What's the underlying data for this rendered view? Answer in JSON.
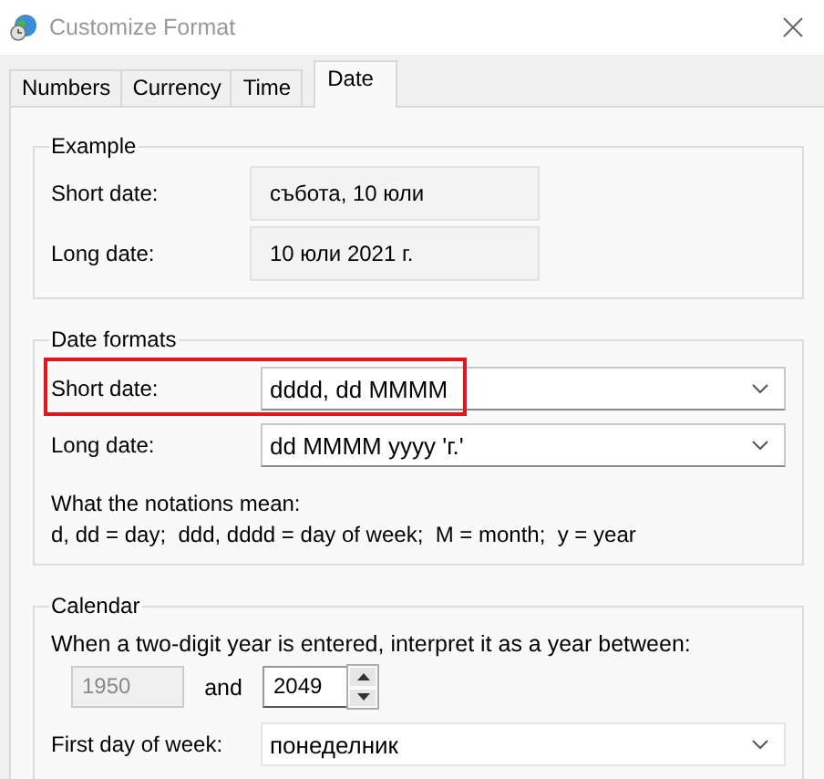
{
  "window": {
    "title": "Customize Format"
  },
  "tabs": [
    {
      "label": "Numbers",
      "selected": false
    },
    {
      "label": "Currency",
      "selected": false
    },
    {
      "label": "Time",
      "selected": false
    },
    {
      "label": "Date",
      "selected": true
    }
  ],
  "example": {
    "title": "Example",
    "rows": [
      {
        "label": "Short date:",
        "value": "събота, 10 юли"
      },
      {
        "label": "Long date:",
        "value": "10 юли 2021 г."
      }
    ]
  },
  "date_formats": {
    "title": "Date formats",
    "rows": [
      {
        "label": "Short date:",
        "value": "dddd, dd MMMM",
        "highlighted": true
      },
      {
        "label": "Long date:",
        "value": "dd MMMM yyyy 'г.'",
        "highlighted": false
      }
    ],
    "notation_title": "What the notations mean:",
    "notation": "d, dd = day;  ddd, dddd = day of week;  M = month;  y = year"
  },
  "calendar": {
    "title": "Calendar",
    "prompt": "When a two-digit year is entered, interpret it as a year between:",
    "from": {
      "value": "1950",
      "disabled": true
    },
    "and": "and",
    "to": {
      "value": "2049",
      "disabled": false
    },
    "first_day": {
      "label": "First day of week:",
      "value": "понеделник"
    }
  }
}
